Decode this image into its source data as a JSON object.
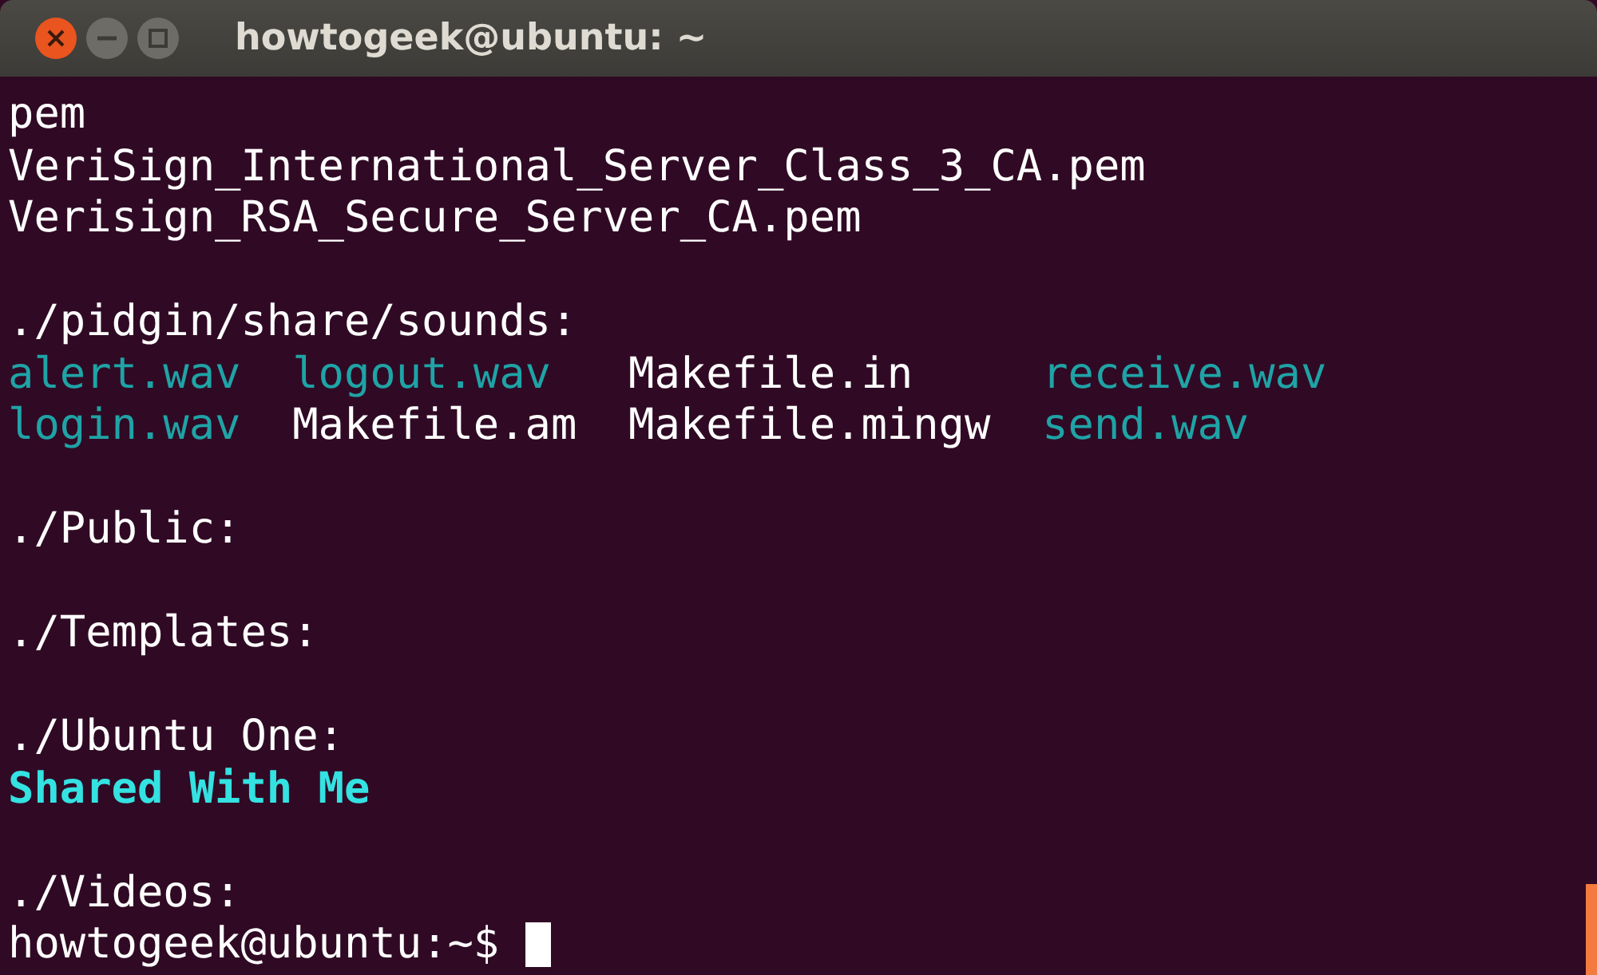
{
  "window": {
    "title": "howtogeek@ubuntu: ~"
  },
  "lines": [
    {
      "kind": "text",
      "text": "pem"
    },
    {
      "kind": "text",
      "text": "VeriSign_International_Server_Class_3_CA.pem"
    },
    {
      "kind": "text",
      "text": "Verisign_RSA_Secure_Server_CA.pem"
    },
    {
      "kind": "blank"
    },
    {
      "kind": "text",
      "text": "./pidgin/share/sounds:"
    },
    {
      "kind": "columns",
      "cells": [
        {
          "kind": "audio",
          "text": "alert.wav"
        },
        {
          "kind": "audio",
          "text": "logout.wav"
        },
        {
          "kind": "plain",
          "text": "Makefile.in"
        },
        {
          "kind": "audio",
          "text": "receive.wav"
        }
      ]
    },
    {
      "kind": "columns",
      "cells": [
        {
          "kind": "audio",
          "text": "login.wav"
        },
        {
          "kind": "plain",
          "text": "Makefile.am"
        },
        {
          "kind": "plain",
          "text": "Makefile.mingw"
        },
        {
          "kind": "audio",
          "text": "send.wav"
        }
      ]
    },
    {
      "kind": "blank"
    },
    {
      "kind": "text",
      "text": "./Public:"
    },
    {
      "kind": "blank"
    },
    {
      "kind": "text",
      "text": "./Templates:"
    },
    {
      "kind": "blank"
    },
    {
      "kind": "text",
      "text": "./Ubuntu One:"
    },
    {
      "kind": "columns",
      "cells": [
        {
          "kind": "directory",
          "text": "Shared With Me"
        }
      ]
    },
    {
      "kind": "blank"
    },
    {
      "kind": "text",
      "text": "./Videos:"
    },
    {
      "kind": "prompt",
      "text": "howtogeek@ubuntu:~$"
    }
  ]
}
